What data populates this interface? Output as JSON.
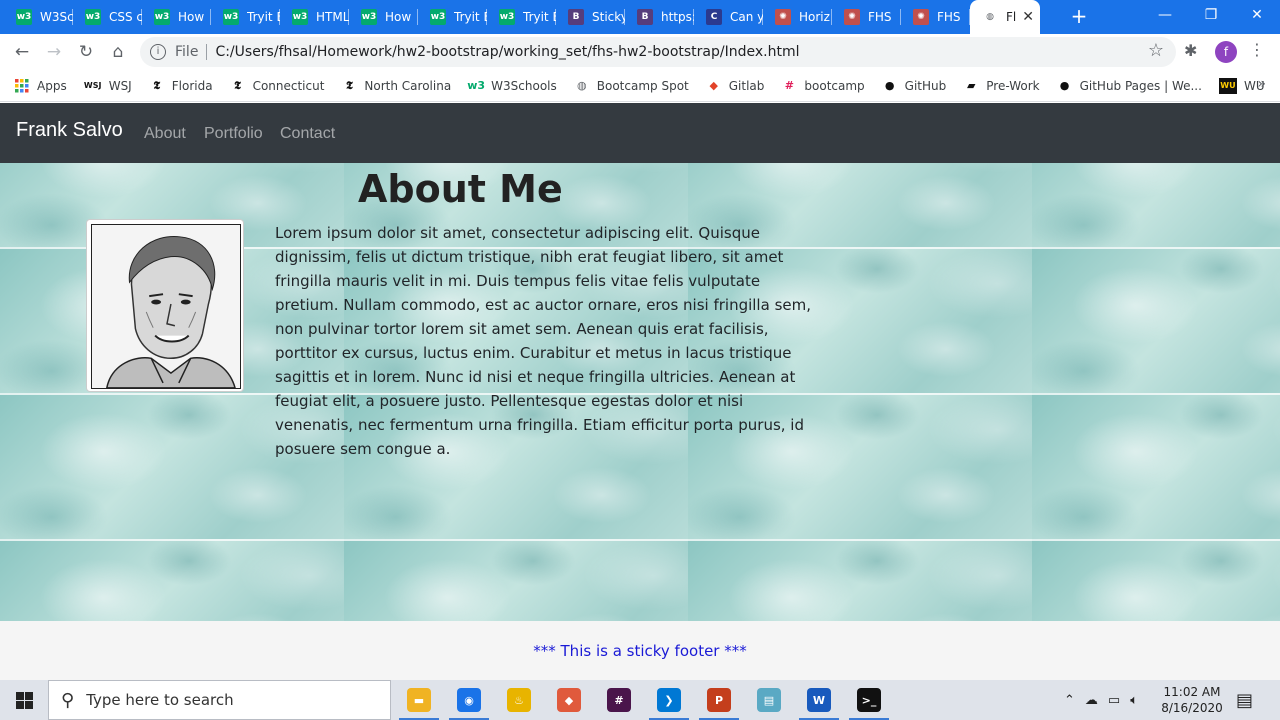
{
  "browser": {
    "tabs": [
      {
        "label": "W3Sc",
        "icon": "w3schools-icon",
        "color": "#04aa6d",
        "glyph": "w3"
      },
      {
        "label": "CSS c",
        "icon": "w3schools-icon",
        "color": "#04aa6d",
        "glyph": "w3"
      },
      {
        "label": "How",
        "icon": "w3schools-icon",
        "color": "#04aa6d",
        "glyph": "w3"
      },
      {
        "label": "Tryit E",
        "icon": "w3schools-icon",
        "color": "#04aa6d",
        "glyph": "w3"
      },
      {
        "label": "HTML",
        "icon": "w3schools-icon",
        "color": "#04aa6d",
        "glyph": "w3"
      },
      {
        "label": "How",
        "icon": "w3schools-icon",
        "color": "#04aa6d",
        "glyph": "w3"
      },
      {
        "label": "Tryit E",
        "icon": "w3schools-icon",
        "color": "#04aa6d",
        "glyph": "w3"
      },
      {
        "label": "Tryit E",
        "icon": "w3schools-icon",
        "color": "#04aa6d",
        "glyph": "w3"
      },
      {
        "label": "Sticky",
        "icon": "bootstrap-icon",
        "color": "#563d7c",
        "glyph": "B"
      },
      {
        "label": "https:",
        "icon": "bootstrap-icon",
        "color": "#563d7c",
        "glyph": "B"
      },
      {
        "label": "Can y",
        "icon": "codeply-icon",
        "color": "#2b3a8f",
        "glyph": "C"
      },
      {
        "label": "Horiz",
        "icon": "gear-site-icon",
        "color": "#c0504d",
        "glyph": "✺"
      },
      {
        "label": "FHS",
        "icon": "gear-site-icon",
        "color": "#c0504d",
        "glyph": "✺"
      },
      {
        "label": "FHS",
        "icon": "gear-site-icon",
        "color": "#c0504d",
        "glyph": "✺"
      },
      {
        "label": "Fl",
        "icon": "globe-icon",
        "color": "#5f6368",
        "glyph": "◍",
        "active": true
      }
    ],
    "new_tab": "+",
    "window_controls": {
      "minimize": "—",
      "restore": "❐",
      "close": "✕"
    },
    "address": {
      "scheme_label": "File",
      "url": "C:/Users/fhsal/Homework/hw2-bootstrap/working_set/fhs-hw2-bootstrap/Index.html"
    },
    "profile_initial": "f",
    "bookmarks": [
      {
        "label": "Apps",
        "icon": "apps-grid-icon"
      },
      {
        "label": "WSJ",
        "icon": "wsj-icon",
        "glyph": "WSJ"
      },
      {
        "label": "Florida",
        "icon": "nyt-icon",
        "glyph": "𝕿"
      },
      {
        "label": "Connecticut",
        "icon": "nyt-icon",
        "glyph": "𝕿"
      },
      {
        "label": "North Carolina",
        "icon": "nyt-icon",
        "glyph": "𝕿"
      },
      {
        "label": "W3Schools",
        "icon": "w3schools-icon",
        "glyph": "w3"
      },
      {
        "label": "Bootcamp Spot",
        "icon": "globe-icon",
        "glyph": "◍"
      },
      {
        "label": "Gitlab",
        "icon": "gitlab-icon",
        "glyph": "◆"
      },
      {
        "label": "bootcamp",
        "icon": "slack-icon",
        "glyph": "#"
      },
      {
        "label": "GitHub",
        "icon": "github-icon",
        "glyph": "●"
      },
      {
        "label": "Pre-Work",
        "icon": "notebook-icon",
        "glyph": "▰"
      },
      {
        "label": "GitHub Pages | We...",
        "icon": "github-icon",
        "glyph": "●"
      },
      {
        "label": "WU",
        "icon": "wu-icon",
        "glyph": "WU"
      }
    ],
    "bookmarks_more": "»"
  },
  "page": {
    "brand": "Frank Salvo",
    "nav": [
      "About",
      "Portfolio",
      "Contact"
    ],
    "heading": "About Me",
    "body": "Lorem ipsum dolor sit amet, consectetur adipiscing elit. Quisque dignissim, felis ut dictum tristique, nibh erat feugiat libero, sit amet fringilla mauris velit in mi. Duis tempus felis vitae felis vulputate pretium. Nullam commodo, est ac auctor ornare, eros nisi fringilla sem, non pulvinar tortor lorem sit amet sem. Aenean quis erat facilisis, porttitor ex cursus, luctus enim. Curabitur et metus in lacus tristique sagittis et in lorem. Nunc id nisi et neque fringilla ultricies. Aenean at feugiat elit, a posuere justo. Pellentesque egestas dolor et nisi venenatis, nec fermentum urna fringilla. Etiam efficitur porta purus, id posuere sem congue a.",
    "footer": "*** This is a sticky footer ***"
  },
  "taskbar": {
    "search_placeholder": "Type here to search",
    "apps": [
      {
        "name": "file-explorer-icon",
        "color": "#f0b323",
        "glyph": "▬",
        "running": true
      },
      {
        "name": "chrome-icon",
        "color": "#1a73e8",
        "glyph": "◉",
        "running": true
      },
      {
        "name": "genie-lamp-icon",
        "color": "#e8b400",
        "glyph": "♨",
        "running": false
      },
      {
        "name": "git-kraken-icon",
        "color": "#e05a3c",
        "glyph": "◆",
        "running": false
      },
      {
        "name": "slack-icon",
        "color": "#4a154b",
        "glyph": "#",
        "running": false
      },
      {
        "name": "vscode-icon",
        "color": "#0078d4",
        "glyph": "❯",
        "running": true
      },
      {
        "name": "powerpoint-icon",
        "color": "#c43e1c",
        "glyph": "P",
        "running": true
      },
      {
        "name": "notepad-icon",
        "color": "#5aa9c4",
        "glyph": "▤",
        "running": false
      },
      {
        "name": "word-icon",
        "color": "#185abd",
        "glyph": "W",
        "running": true
      },
      {
        "name": "terminal-icon",
        "color": "#111111",
        "glyph": ">_",
        "running": true
      }
    ],
    "time": "11:02 AM",
    "date": "8/16/2020"
  }
}
